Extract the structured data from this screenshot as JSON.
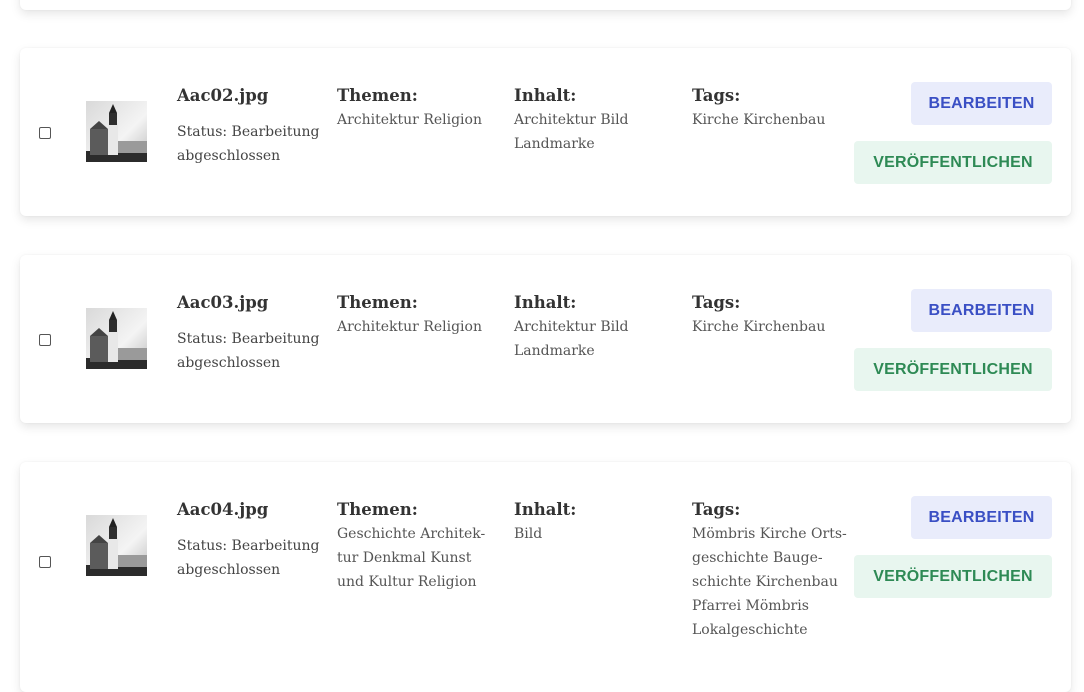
{
  "labels": {
    "themen": "Themen:",
    "inhalt": "Inhalt:",
    "tags": "Tags:",
    "edit": "BEARBEITEN",
    "publish": "VERÖFFENTLICHEN"
  },
  "items": [
    {
      "filename": "Aac02.jpg",
      "status": "Status: Bearbeitung abgeschlossen",
      "themen": "Architektur Religion",
      "inhalt": "Architektur Bild Landmarke",
      "tags": "Kirche Kirchenbau"
    },
    {
      "filename": "Aac03.jpg",
      "status": "Status: Bearbeitung abgeschlossen",
      "themen": "Architektur Religion",
      "inhalt": "Architektur Bild Landmarke",
      "tags": "Kirche Kirchenbau"
    },
    {
      "filename": "Aac04.jpg",
      "status": "Status: Bearbeitung abgeschlossen",
      "themen": "Geschichte Architek-tur Denkmal Kunst und Kultur Religion",
      "inhalt": "Bild",
      "tags": "Mömbris Kirche Orts-geschichte Bauge-schichte Kirchenbau Pfarrei Mömbris Lokalgeschichte"
    }
  ],
  "colors": {
    "edit_bg": "#e9ecfb",
    "edit_text": "#3a4fc4",
    "publish_bg": "#e8f6ef",
    "publish_text": "#2e8a55"
  },
  "icons": {
    "thumbnail": "church-photo-thumbnail"
  }
}
